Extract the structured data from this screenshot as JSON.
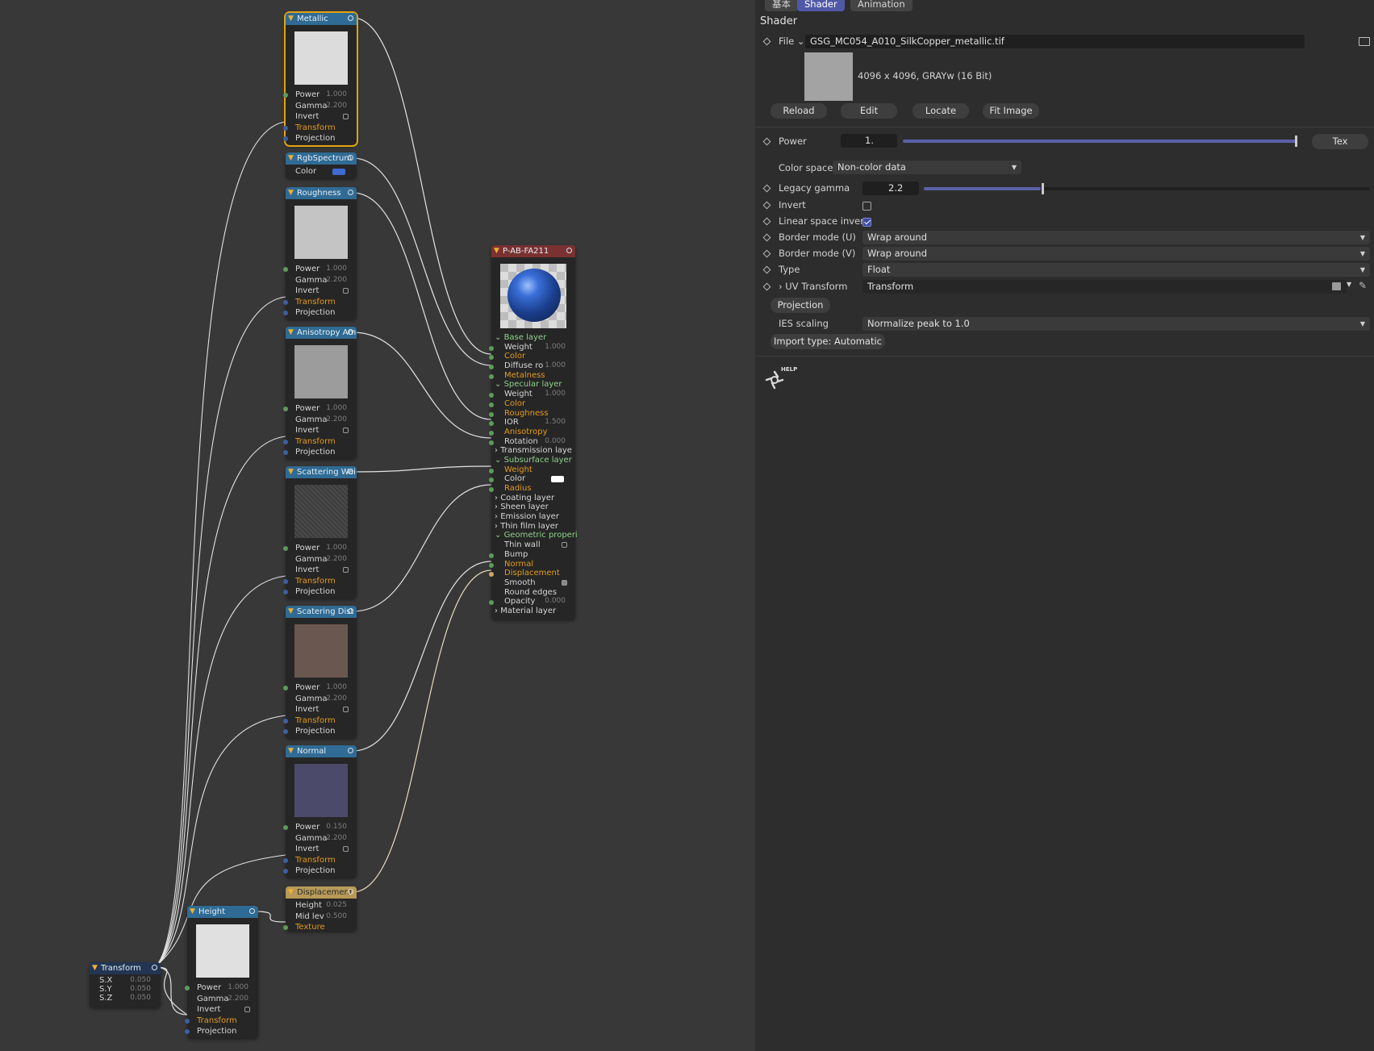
{
  "graph": {
    "nodes": {
      "metallic": {
        "title": "Metallic",
        "power": "1.000",
        "gamma": "2.200"
      },
      "rgb": {
        "title": "RgbSpectrum",
        "color": "#3e6ad1"
      },
      "roughness": {
        "title": "Roughness",
        "power": "1.000",
        "gamma": "2.200"
      },
      "anisotropy": {
        "title": "Anisotropy Am",
        "power": "1.000",
        "gamma": "2.200"
      },
      "scatter_weight": {
        "title": "Scattering Wei",
        "power": "1.000",
        "gamma": "2.200"
      },
      "scatter_dist": {
        "title": "Scatering Dist",
        "power": "1.000",
        "gamma": "2.200"
      },
      "normal": {
        "title": "Normal",
        "power": "0.150",
        "gamma": "2.200"
      },
      "displacement": {
        "title": "Displacement",
        "height": "0.025",
        "mid": "0.500"
      },
      "height": {
        "title": "Height",
        "power": "1.000",
        "gamma": "2.200"
      },
      "transform": {
        "title": "Transform",
        "sx": "0.050",
        "sy": "0.050",
        "sz": "0.050"
      },
      "material": {
        "title": "P-AB-FA211"
      }
    },
    "labels": {
      "power": "Power",
      "gamma": "Gamma",
      "invert": "Invert",
      "transform": "Transform",
      "projection": "Projection",
      "color": "Color",
      "height": "Height",
      "mid": "Mid lev",
      "texture": "Texture",
      "sx": "S.X",
      "sy": "S.Y",
      "sz": "S.Z"
    },
    "material_rows": {
      "base_layer": "Base layer",
      "weight": "Weight",
      "weight_v": "1.000",
      "color": "Color",
      "diffuse": "Diffuse ro",
      "diffuse_v": "1.000",
      "metalness": "Metalness",
      "specular_layer": "Specular layer",
      "spec_weight": "Weight",
      "spec_weight_v": "1.000",
      "spec_color": "Color",
      "roughness": "Roughness",
      "ior": "IOR",
      "ior_v": "1.500",
      "anisotropy": "Anisotropy",
      "rotation": "Rotation",
      "rotation_v": "0.000",
      "transmission_layer": "Transmission laye",
      "subsurface_layer": "Subsurface layer",
      "sub_weight": "Weight",
      "sub_color": "Color",
      "radius": "Radius",
      "coating_layer": "Coating layer",
      "sheen_layer": "Sheen layer",
      "emission_layer": "Emission layer",
      "thin_film_layer": "Thin film layer",
      "geometric": "Geometric properi",
      "thin_wall": "Thin wall",
      "bump": "Bump",
      "normal": "Normal",
      "displacement": "Displacement",
      "smooth": "Smooth",
      "round_edges": "Round edges",
      "opacity": "Opacity",
      "opacity_v": "0.000",
      "material_layer": "Material layer"
    }
  },
  "panel": {
    "tabs": [
      "基本",
      "Shader",
      "Animation"
    ],
    "title": "Shader",
    "file_label": "File",
    "file_value": "GSG_MC054_A010_SilkCopper_metallic.tif",
    "image_info": "4096 x 4096, GRAYw (16 Bit)",
    "buttons": {
      "reload": "Reload",
      "edit": "Edit",
      "locate": "Locate",
      "fit": "Fit Image",
      "tex": "Tex",
      "projection": "Projection",
      "import": "Import type: Automatic"
    },
    "power_label": "Power",
    "power_value": "1.",
    "power_level": 1.0,
    "color_space_label": "Color space",
    "color_space_value": "Non-color data",
    "legacy_gamma_label": "Legacy gamma",
    "legacy_gamma_value": "2.2",
    "invert_label": "Invert",
    "linear_invert_label": "Linear space invert",
    "border_u_label": "Border mode (U)",
    "border_u_value": "Wrap around",
    "border_v_label": "Border mode (V)",
    "border_v_value": "Wrap around",
    "type_label": "Type",
    "type_value": "Float",
    "uv_label": "UV Transform",
    "uv_value": "Transform",
    "ies_label": "IES scaling",
    "ies_value": "Normalize peak to 1.0",
    "help_label": "HELP",
    "accent": "#5059a7"
  }
}
